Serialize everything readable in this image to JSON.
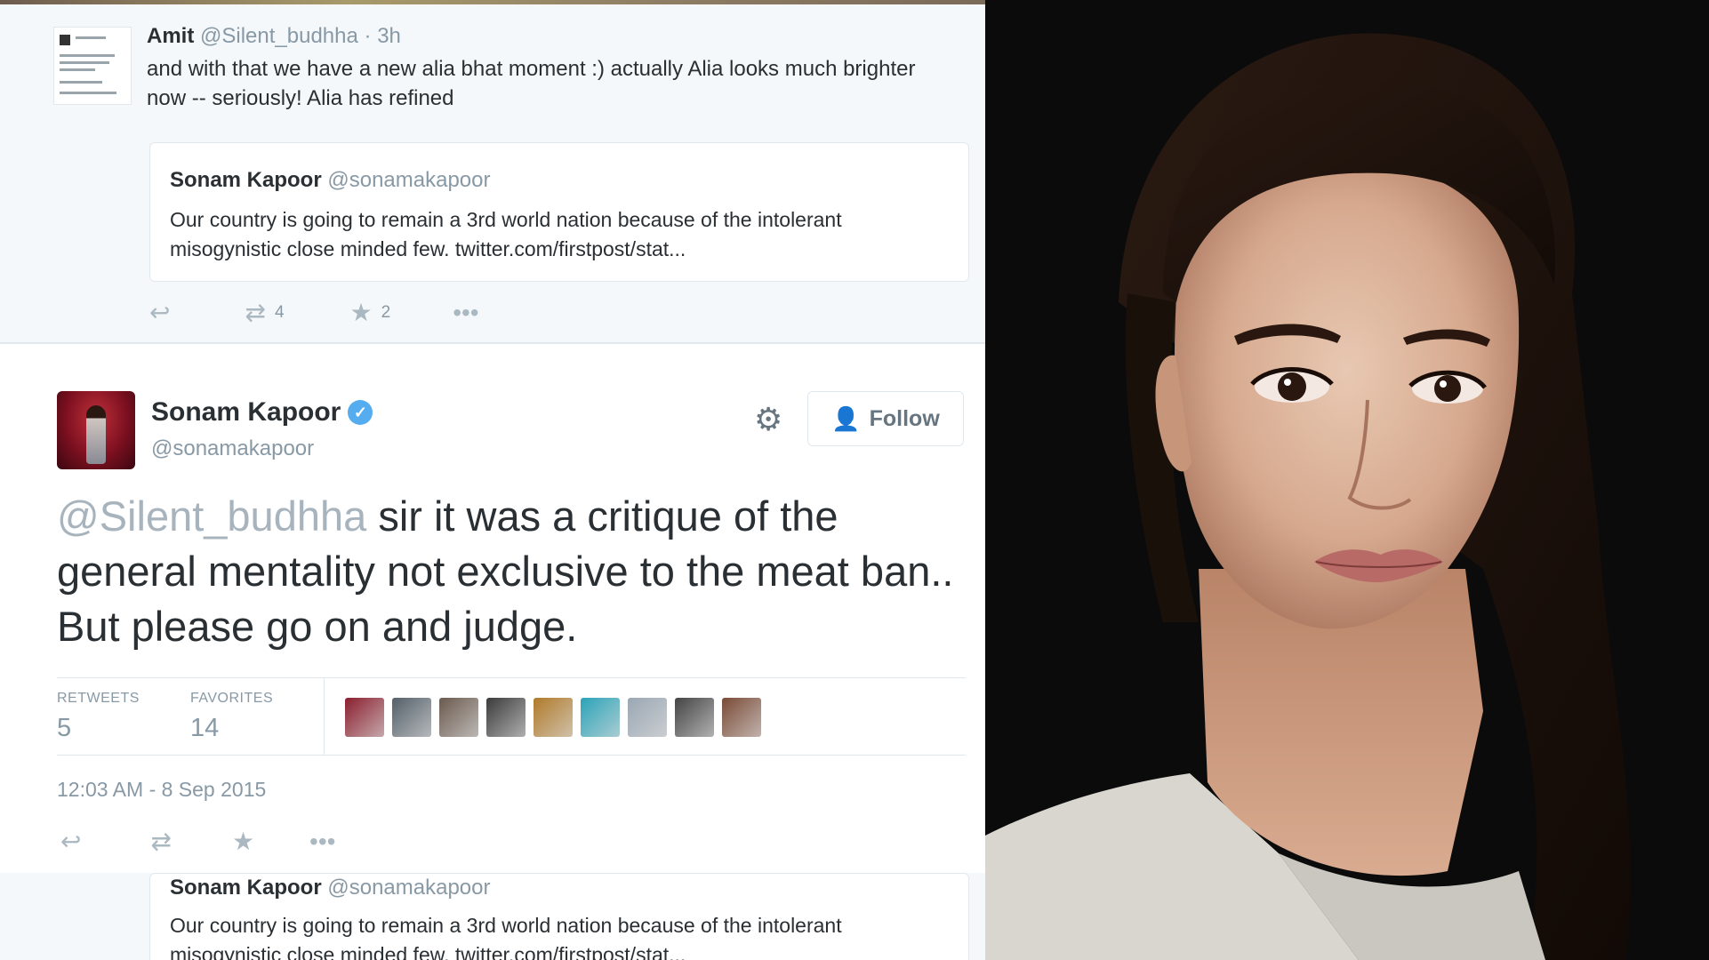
{
  "reply": {
    "name": "Amit",
    "handle": "@Silent_budhha",
    "time": "· 3h",
    "text": "and with that we have a new alia bhat moment :) actually Alia looks much brighter now -- seriously! Alia has refined",
    "quote": {
      "name": "Sonam Kapoor",
      "handle": "@sonamakapoor",
      "text": "Our country is going to remain a 3rd world nation because of the intolerant misogynistic close minded few.   twitter.com/firstpost/stat..."
    },
    "actions": {
      "reply_icon": "reply-icon",
      "retweet_icon": "retweet-icon",
      "retweet_count": "4",
      "favorite_icon": "star-icon",
      "favorite_count": "2",
      "more_icon": "more-icon"
    }
  },
  "main": {
    "name": "Sonam Kapoor",
    "handle": "@sonamakapoor",
    "verified_icon": "verified-badge-icon",
    "follow_label": "Follow",
    "mention": "@Silent_budhha",
    "text": " sir it was a critique of the general mentality not exclusive to the meat ban.. But please go on and judge.",
    "stats": {
      "retweets_label": "RETWEETS",
      "retweets": "5",
      "favorites_label": "FAVORITES",
      "favorites": "14"
    },
    "faces": [
      "#8a1f2e",
      "#55606a",
      "#6b5a4e",
      "#3b3b3b",
      "#b07a2a",
      "#2ba3b8",
      "#9aa7b3",
      "#444444",
      "#7a4a36"
    ],
    "timestamp": "12:03 AM - 8 Sep 2015"
  },
  "quote2": {
    "name": "Sonam Kapoor",
    "handle": "@sonamakapoor",
    "text": "Our country is going to remain a 3rd world nation because of the intolerant misogynistic close minded few.   twitter.com/firstpost/stat..."
  },
  "colors": {
    "accent": "#55acee",
    "text": "#292f33",
    "muted": "#8899a6"
  }
}
